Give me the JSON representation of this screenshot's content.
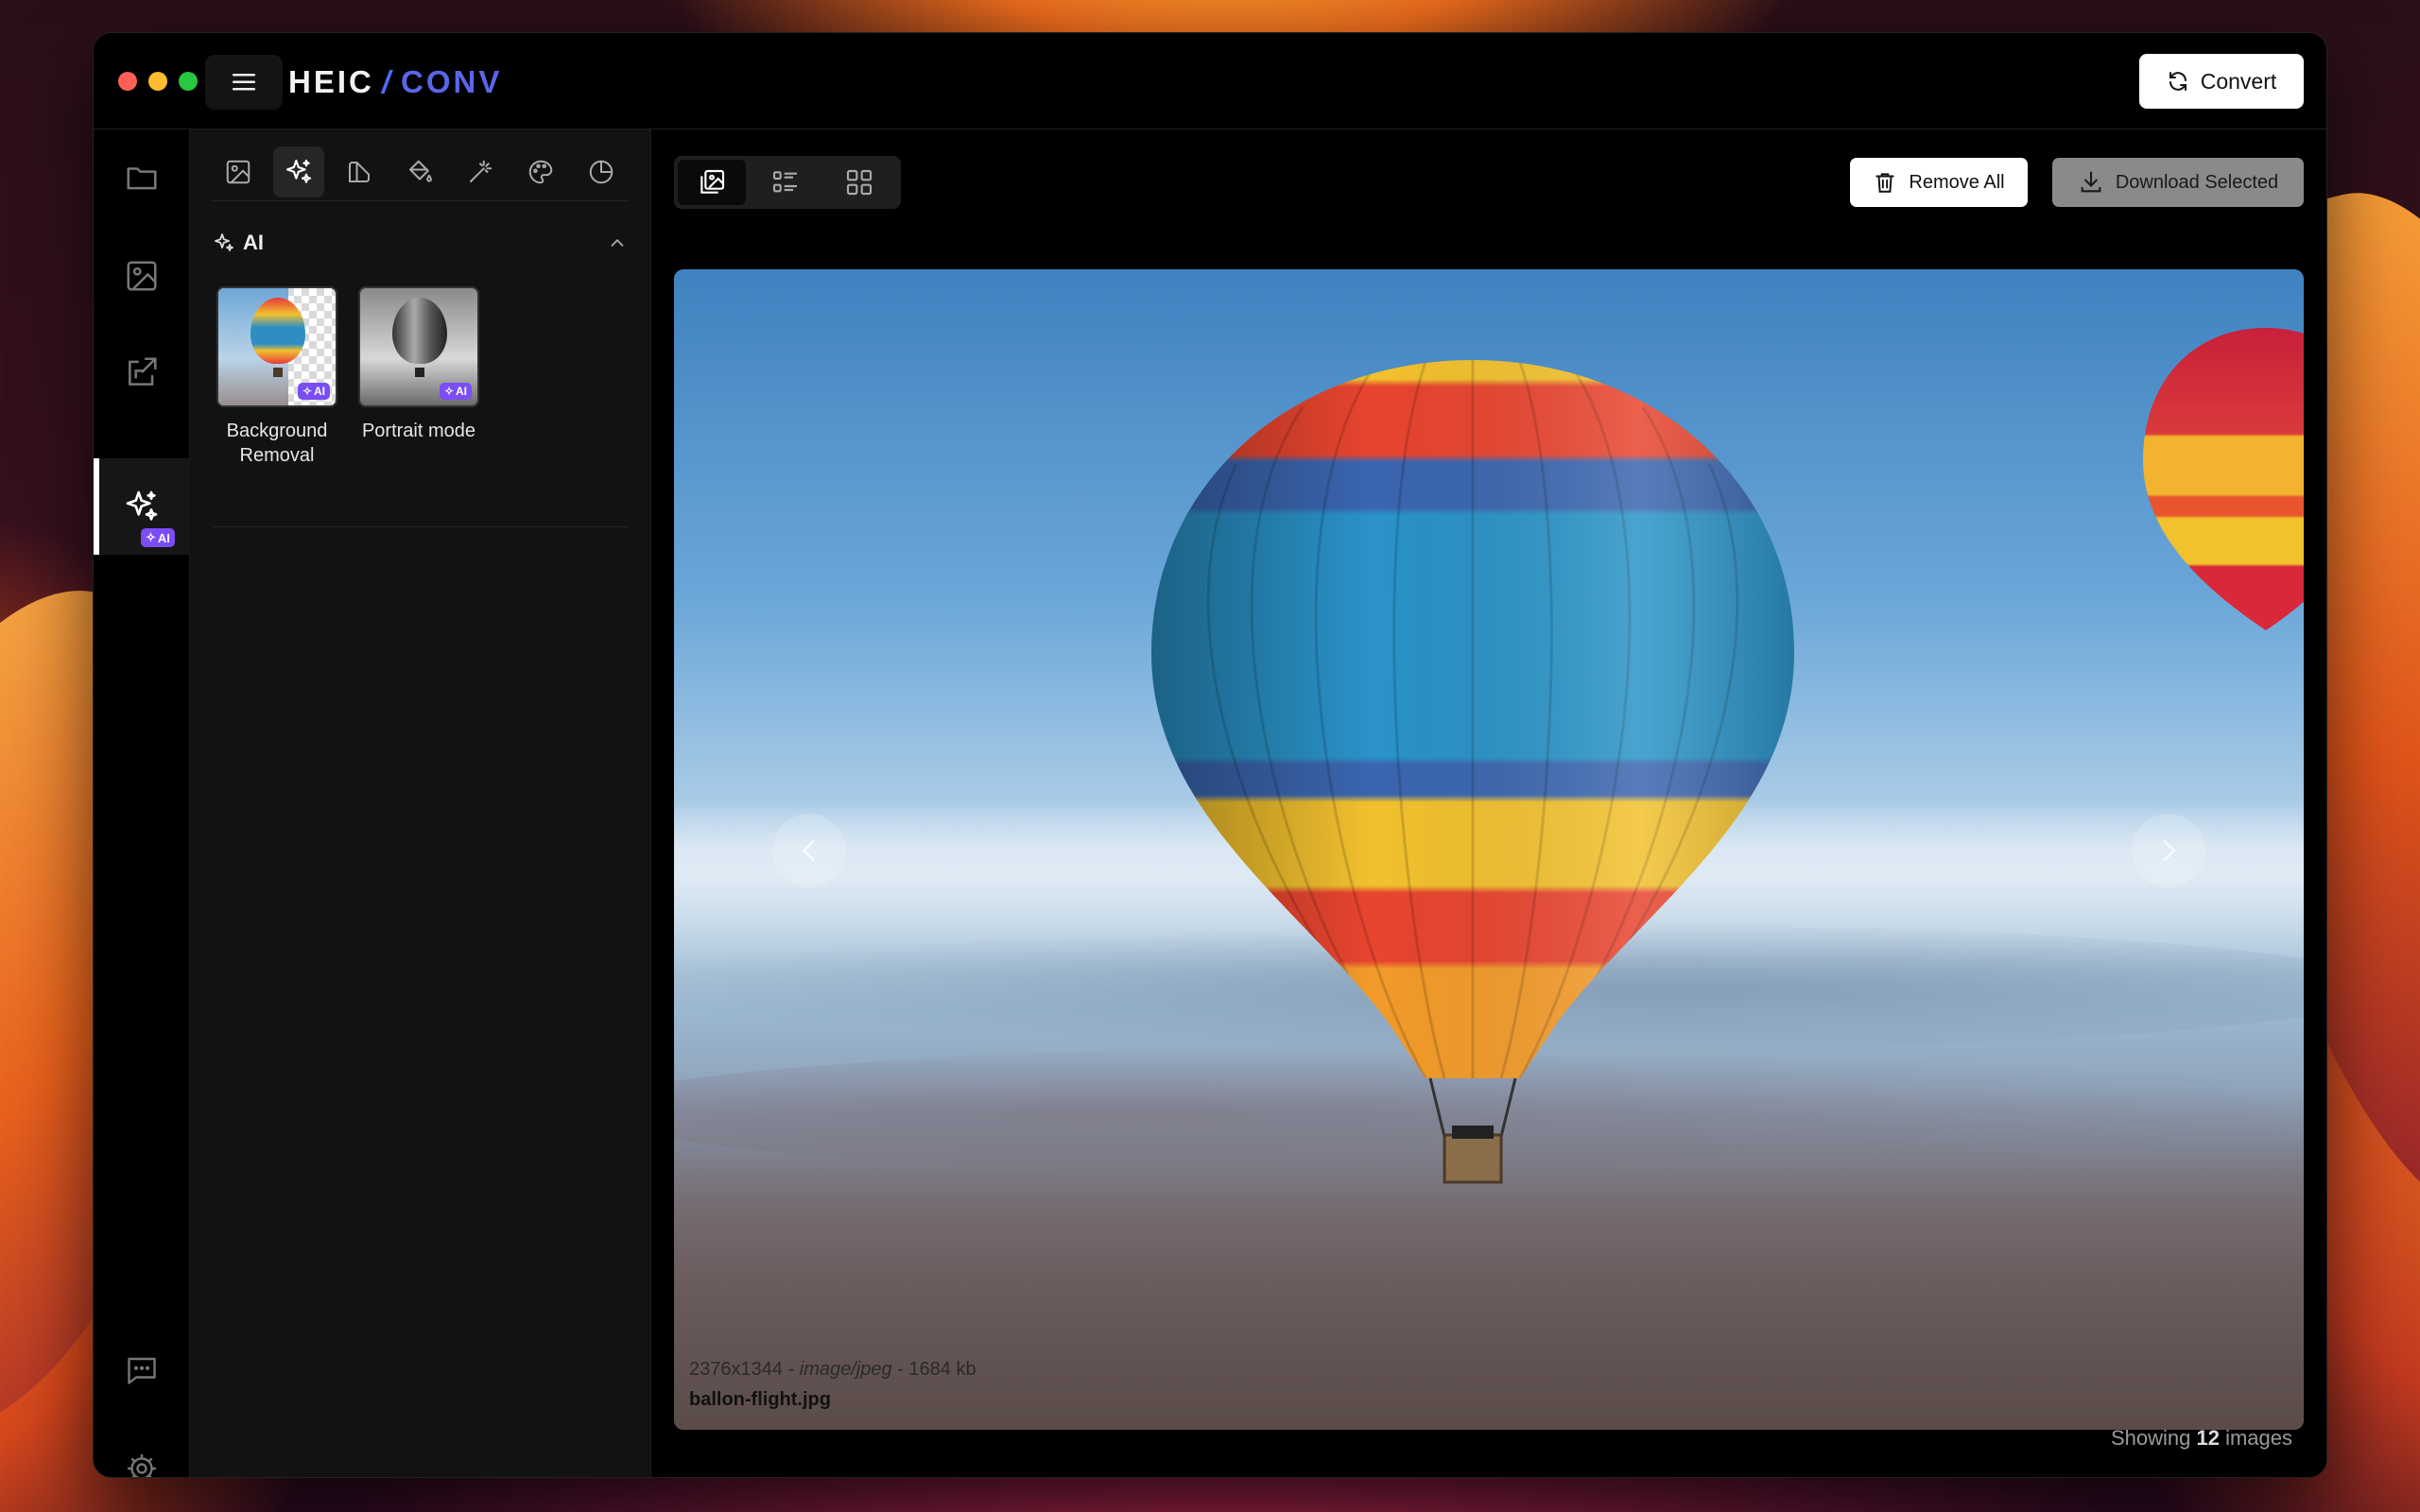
{
  "app": {
    "logo_left": "HEIC",
    "logo_slash": "/",
    "logo_right": "CONV",
    "convert_label": "Convert",
    "accent": "#5a66e8",
    "ai_badge_color": "#7a4df5"
  },
  "rail": {
    "items": [
      {
        "name": "folder-icon"
      },
      {
        "name": "image-icon"
      },
      {
        "name": "resize-icon"
      },
      {
        "name": "ai-sparkle-icon",
        "active": true,
        "badge": "AI"
      },
      {
        "name": "chat-icon"
      },
      {
        "name": "gear-icon"
      }
    ]
  },
  "panel": {
    "tools": [
      "image-icon",
      "ai-sparkle-icon",
      "crop-icon",
      "paint-bucket-icon",
      "magic-wand-icon",
      "palette-icon",
      "pie-chart-icon"
    ],
    "section_title": "AI",
    "cards": [
      {
        "line1": "Background",
        "line2": "Removal",
        "badge": "AI"
      },
      {
        "line1": "Portrait mode",
        "line2": "",
        "badge": "AI"
      }
    ]
  },
  "toolbar": {
    "view_modes": [
      "single-view-icon",
      "list-view-icon",
      "grid-view-icon"
    ],
    "remove_all_label": "Remove All",
    "download_selected_label": "Download Selected"
  },
  "viewer": {
    "dimensions": "2376x1344",
    "sep1": " - ",
    "mime": "image/jpeg",
    "sep2": " - ",
    "size": "1684 kb",
    "filename": "ballon-flight.jpg"
  },
  "footer": {
    "showing_prefix": "Showing",
    "count": "12",
    "showing_suffix": "images"
  }
}
